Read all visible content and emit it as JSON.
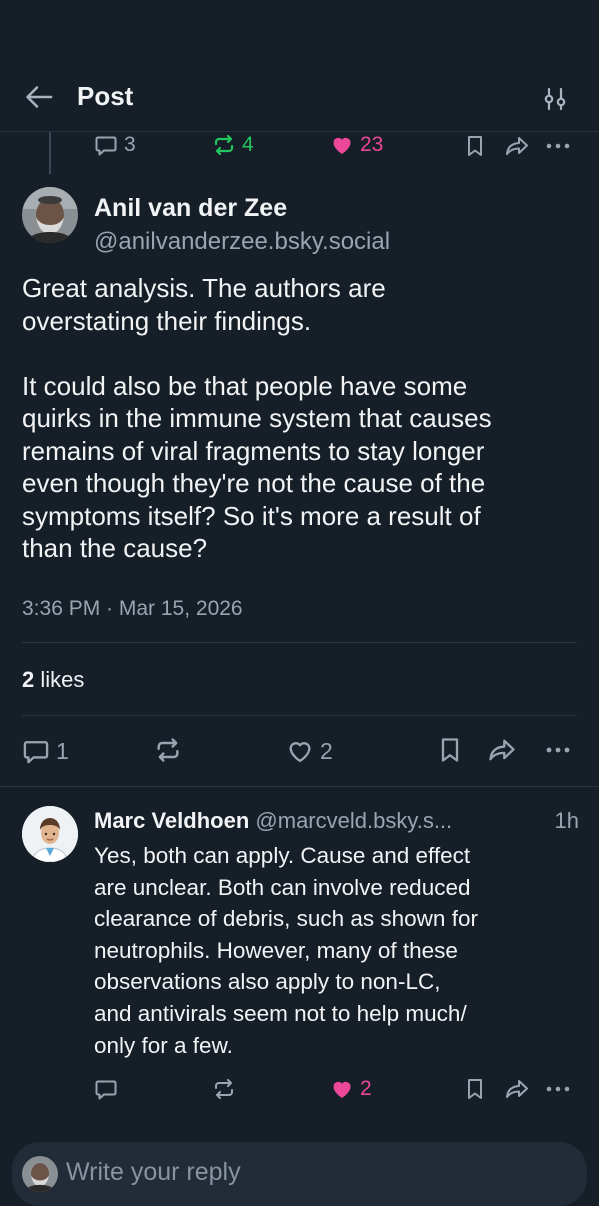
{
  "header": {
    "title": "Post"
  },
  "parent_actions": {
    "replies": "3",
    "reposts": "4",
    "likes": "23"
  },
  "post": {
    "author_name": "Anil van der Zee",
    "author_handle": "@anilvanderzee.bsky.social",
    "body": "Great analysis. The authors are\noverstating their findings.\n\nIt could also be that people have some\nquirks in the immune system that causes\nremains of viral fragments to stay longer\neven though they're not the cause of the\nsymptoms itself? So it's more a result of\nthan the cause?",
    "timestamp": "3:36 PM · Mar 15, 2026",
    "likes_count": "2",
    "likes_label": "likes",
    "actions": {
      "replies": "1",
      "likes": "2"
    }
  },
  "reply": {
    "author_name": "Marc Veldhoen",
    "author_handle": "@marcveld.bsky.s...",
    "time": "1h",
    "body": "Yes, both can apply. Cause and effect\nare unclear. Both can involve reduced\nclearance of debris, such as shown for\nneutrophils. However, many of these\nobservations also apply to non-LC,\nand antivirals seem not to help much/\nonly for a few.",
    "actions": {
      "likes": "2"
    }
  },
  "composer": {
    "placeholder": "Write your reply"
  },
  "colors": {
    "background": "#161e27",
    "muted": "#9aa4b1",
    "repost_active": "#22c55e",
    "like_active": "#ec4899",
    "composer_bg": "#222c38"
  }
}
